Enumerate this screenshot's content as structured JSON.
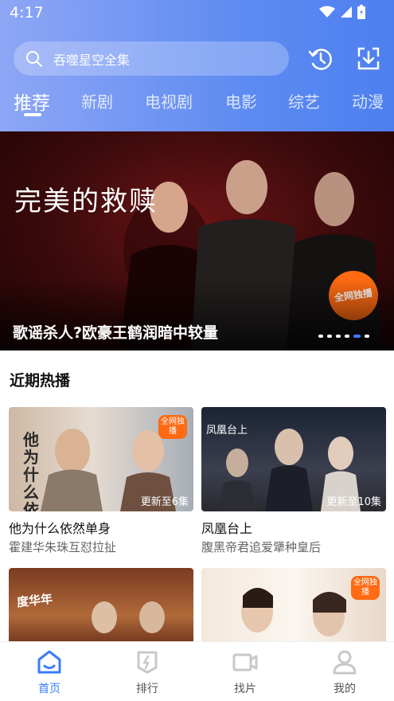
{
  "status": {
    "time": "4:17"
  },
  "search": {
    "placeholder": "吞噬星空全集"
  },
  "tabs": [
    {
      "label": "推荐",
      "active": true
    },
    {
      "label": "新剧"
    },
    {
      "label": "电视剧"
    },
    {
      "label": "电影"
    },
    {
      "label": "综艺"
    },
    {
      "label": "动漫"
    }
  ],
  "banner": {
    "show_title": "完美的救赎",
    "badge": "全网独播",
    "caption": "歌谣杀人?欧豪王鹤润暗中较量",
    "slide_count": 6,
    "active_slide": 5
  },
  "section": {
    "title": "近期热播"
  },
  "cards": [
    {
      "title": "他为什么依然单身",
      "subtitle": "霍建华朱珠互怼拉扯",
      "update": "更新至6集",
      "tag": "全网独播",
      "poster_text": "他为什么依然单身"
    },
    {
      "title": "凤凰台上",
      "subtitle": "腹黑帝君追爱犟种皇后",
      "update": "更新至10集",
      "poster_text": "凤凰台上"
    },
    {
      "title": "",
      "subtitle": "",
      "poster_text": "度华年"
    },
    {
      "title": "",
      "subtitle": "",
      "tag": "全网独播"
    }
  ],
  "nav": [
    {
      "label": "首页",
      "active": true
    },
    {
      "label": "排行"
    },
    {
      "label": "找片"
    },
    {
      "label": "我的"
    }
  ],
  "colors": {
    "accent": "#3b7bff",
    "header_start": "#8ea6f5",
    "header_end": "#4d7ff0",
    "badge": "#ff6a12"
  }
}
